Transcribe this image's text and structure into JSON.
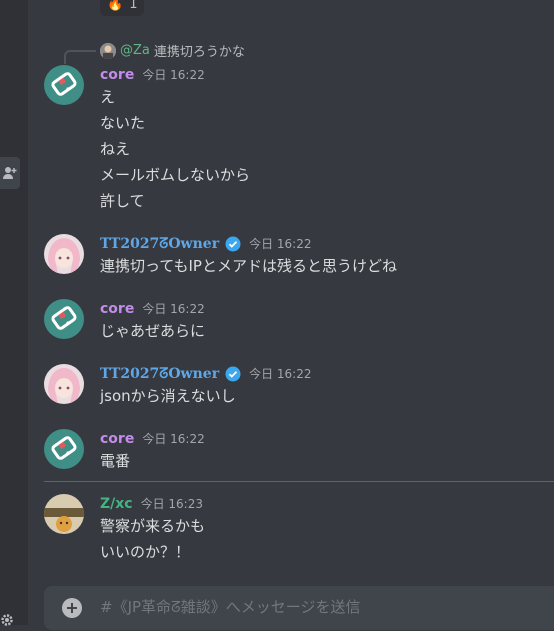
{
  "reaction": {
    "emoji": "🔥",
    "count": "1"
  },
  "reply": {
    "mention": "@Za",
    "text": "連携切ろうかな"
  },
  "messages": [
    {
      "author": "core",
      "time": "今日 16:22",
      "lines": [
        "え",
        "ないた",
        "ねえ",
        "メールボムしないから",
        "許して"
      ]
    },
    {
      "author": "TT2027ᘔOwner",
      "time": "今日 16:22",
      "lines": [
        "連携切ってもIPとメアドは残ると思うけどね"
      ]
    },
    {
      "author": "core",
      "time": "今日 16:22",
      "lines": [
        "じゃあぜあらに"
      ]
    },
    {
      "author": "TT2027ᘔOwner",
      "time": "今日 16:22",
      "lines": [
        "jsonから消えないし"
      ]
    },
    {
      "author": "core",
      "time": "今日 16:22",
      "lines": [
        "電番"
      ]
    },
    {
      "author": "Z/xc",
      "time": "今日 16:23",
      "lines": [
        "警察が来るかも",
        "いいのか？！"
      ]
    }
  ],
  "composer": {
    "placeholder": "#《JP革命ᘔ雑談》へメッセージを送信"
  },
  "colors": {
    "core": "#c28ce8",
    "owner": "#5fa7e8",
    "za": "#43b581",
    "background": "#36393f",
    "new_divider": "#c0393b"
  },
  "icons": {
    "add_member": "add-member-icon",
    "verified": "verified-badge-icon",
    "attach": "plus-circle-icon",
    "settings": "gear-icon"
  }
}
